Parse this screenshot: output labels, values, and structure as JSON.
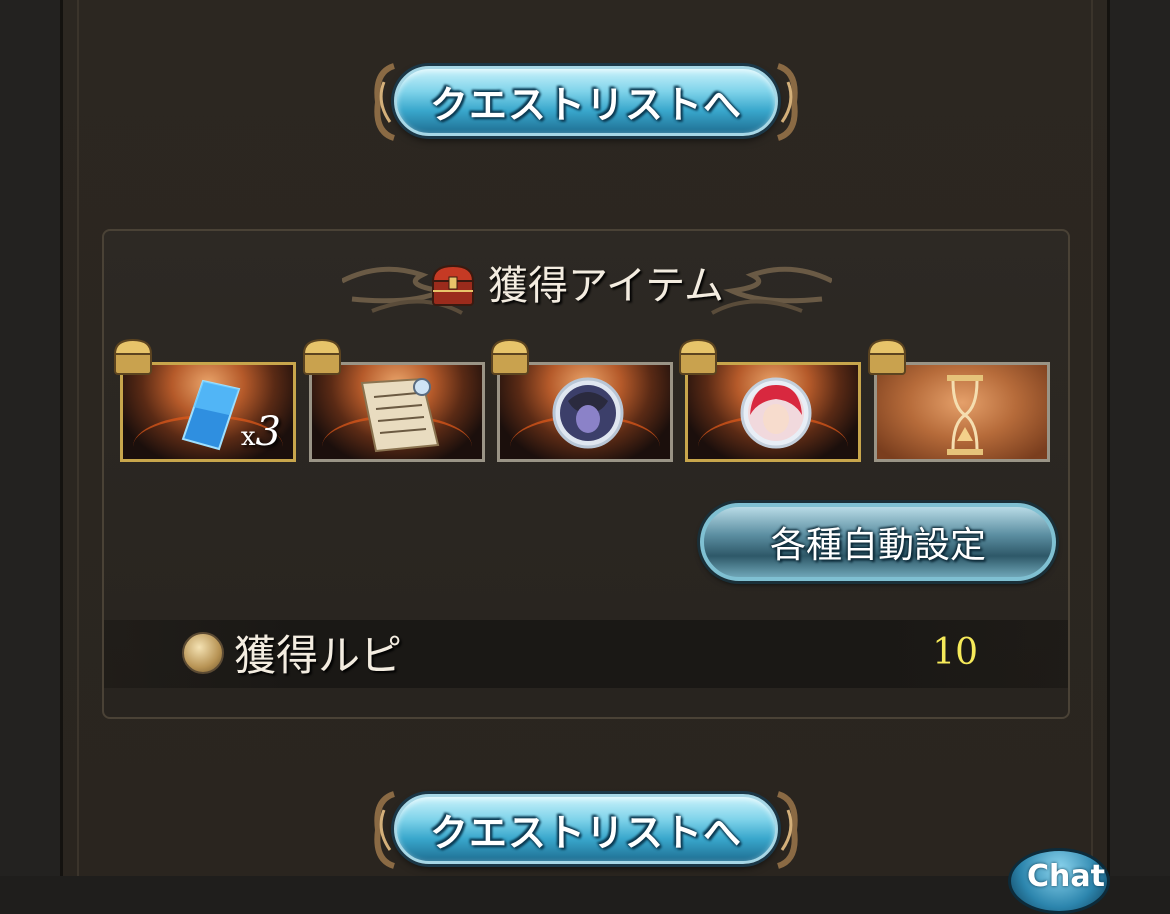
{
  "quest_list_button_top": {
    "label": "クエストリストへ"
  },
  "items_panel": {
    "title": "獲得アイテム",
    "items": [
      {
        "icon": "blue-crystal-item",
        "quantity_prefix": "x",
        "quantity": "3",
        "frame": "gold"
      },
      {
        "icon": "scroll-document-item",
        "frame": "silver"
      },
      {
        "icon": "character-orb-dark-item",
        "frame": "silver"
      },
      {
        "icon": "character-orb-red-hair-item",
        "frame": "gold"
      },
      {
        "icon": "hourglass-item",
        "frame": "silver"
      }
    ],
    "auto_settings_button": "各種自動設定",
    "rupie_label": "獲得ルピ",
    "rupie_value": "10"
  },
  "quest_list_button_bottom": {
    "label": "クエストリストへ"
  },
  "chat_button": {
    "label": "Chat"
  },
  "colors": {
    "button_blue": "#7fd3ea",
    "rupie_value": "#f6ea5a",
    "panel_border": "#4a4236"
  }
}
